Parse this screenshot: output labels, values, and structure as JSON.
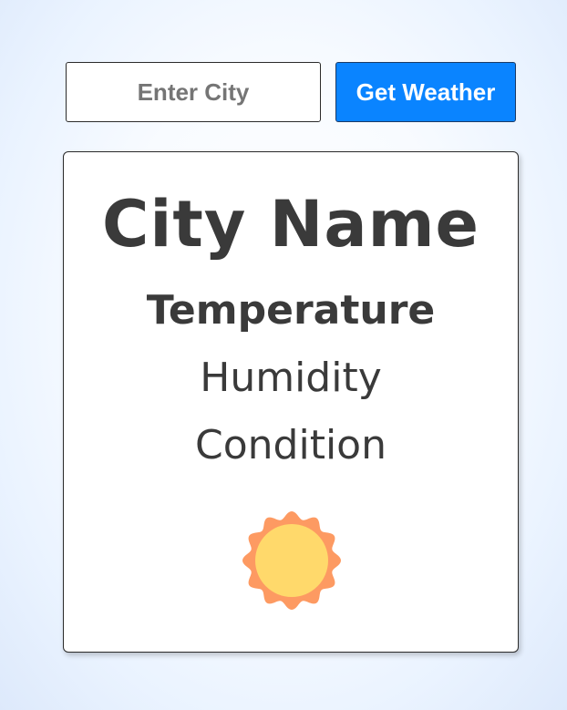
{
  "search": {
    "placeholder": "Enter City",
    "value": ""
  },
  "toolbar": {
    "get_weather_label": "Get Weather"
  },
  "weather_card": {
    "city_name": "City Name",
    "temperature_label": "Temperature",
    "humidity_label": "Humidity",
    "condition_label": "Condition",
    "icon": "sun-icon"
  },
  "colors": {
    "button_background": "#0a84ff",
    "sun_outer": "#fd9a62",
    "sun_inner": "#ffd96b"
  }
}
